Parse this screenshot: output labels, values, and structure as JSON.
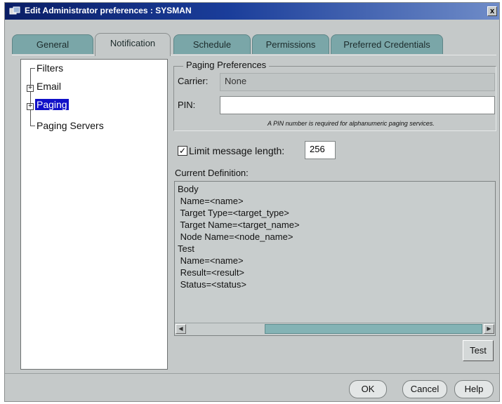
{
  "window": {
    "title": "Edit Administrator preferences : SYSMAN",
    "close_label": "x"
  },
  "tabs": [
    {
      "label": "General",
      "active": false
    },
    {
      "label": "Notification",
      "active": true
    },
    {
      "label": "Schedule",
      "active": false
    },
    {
      "label": "Permissions",
      "active": false
    },
    {
      "label": "Preferred Credentials",
      "active": false
    }
  ],
  "tree": {
    "items": [
      {
        "label": "Filters",
        "expandable": false,
        "selected": false
      },
      {
        "label": "Email",
        "expandable": true,
        "selected": false
      },
      {
        "label": "Paging",
        "expandable": true,
        "selected": true
      },
      {
        "label": "Paging Servers",
        "expandable": false,
        "selected": false
      }
    ]
  },
  "paging": {
    "group_title": "Paging Preferences",
    "carrier_label": "Carrier:",
    "carrier_value": "None",
    "pin_label": "PIN:",
    "pin_value": "",
    "pin_note": "A PIN number is required for alphanumeric paging services.",
    "limit_label": "Limit message length:",
    "limit_checked": true,
    "limit_value": "256"
  },
  "definition": {
    "label": "Current Definition:",
    "lines": [
      "Body",
      " Name=<name>",
      " Target Type=<target_type>",
      " Target Name=<target_name>",
      " Node Name=<node_name>",
      "Test",
      " Name=<name>",
      " Result=<result>",
      " Status=<status>"
    ]
  },
  "buttons": {
    "test": "Test",
    "ok": "OK",
    "cancel": "Cancel",
    "help": "Help"
  },
  "colors": {
    "tab_inactive": "#7aa6a8",
    "panel": "#c5c9c9",
    "title_bar": "#0a1e66",
    "selection": "#1010c8"
  }
}
